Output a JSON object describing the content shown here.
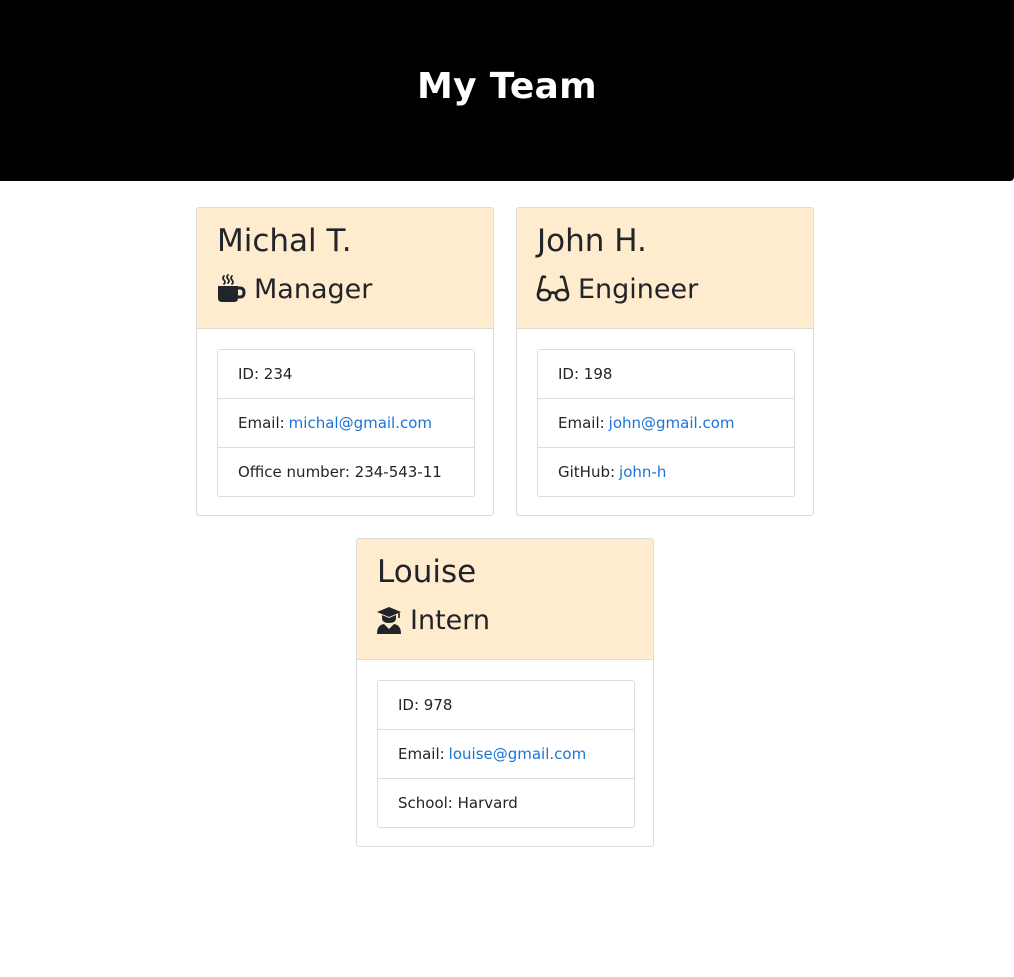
{
  "header": {
    "title": "My Team"
  },
  "colors": {
    "header_bg": "#000000",
    "card_head_bg": "#ffebcd",
    "link": "#1a73d8"
  },
  "cards": [
    {
      "name": "Michal T.",
      "role": "Manager",
      "icon": "coffee-mug-icon",
      "id_label": "ID: 234",
      "email_prefix": "Email:",
      "email": "michal@gmail.com",
      "extra": "Office number: 234-543-11"
    },
    {
      "name": "John H.",
      "role": "Engineer",
      "icon": "glasses-icon",
      "id_label": "ID: 198",
      "email_prefix": "Email:",
      "email": "john@gmail.com",
      "extra_prefix": "GitHub:",
      "extra_link": "john-h"
    },
    {
      "name": "Louise",
      "role": "Intern",
      "icon": "graduate-icon",
      "id_label": "ID: 978",
      "email_prefix": "Email:",
      "email": "louise@gmail.com",
      "extra": "School: Harvard"
    }
  ]
}
